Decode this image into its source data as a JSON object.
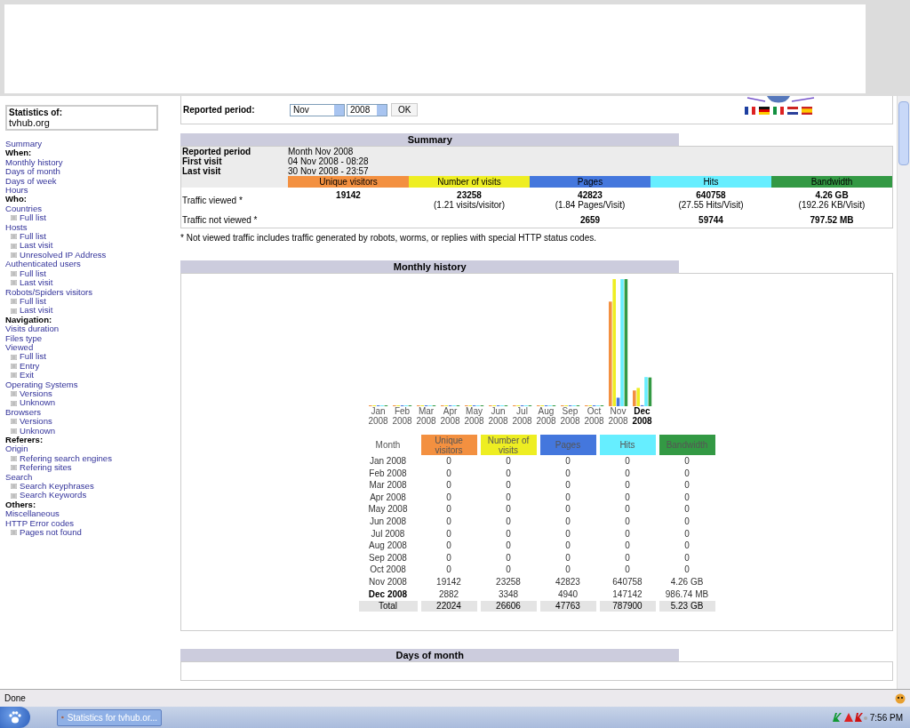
{
  "sidebar": {
    "title": "Statistics of:",
    "site": "tvhub.org",
    "items": [
      {
        "label": "Summary",
        "kind": "link"
      },
      {
        "label": "When:",
        "kind": "heading"
      },
      {
        "label": "Monthly history",
        "kind": "link"
      },
      {
        "label": "Days of month",
        "kind": "link"
      },
      {
        "label": "Days of week",
        "kind": "link"
      },
      {
        "label": "Hours",
        "kind": "link"
      },
      {
        "label": "Who:",
        "kind": "heading"
      },
      {
        "label": "Countries",
        "kind": "link"
      },
      {
        "label": "Full list",
        "kind": "sublink"
      },
      {
        "label": "Hosts",
        "kind": "link"
      },
      {
        "label": "Full list",
        "kind": "sublink"
      },
      {
        "label": "Last visit",
        "kind": "sublink"
      },
      {
        "label": "Unresolved IP Address",
        "kind": "sublink"
      },
      {
        "label": "Authenticated users",
        "kind": "link"
      },
      {
        "label": "Full list",
        "kind": "sublink"
      },
      {
        "label": "Last visit",
        "kind": "sublink"
      },
      {
        "label": "Robots/Spiders visitors",
        "kind": "link"
      },
      {
        "label": "Full list",
        "kind": "sublink"
      },
      {
        "label": "Last visit",
        "kind": "sublink"
      },
      {
        "label": "Navigation:",
        "kind": "heading"
      },
      {
        "label": "Visits duration",
        "kind": "link"
      },
      {
        "label": "Files type",
        "kind": "link"
      },
      {
        "label": "Viewed",
        "kind": "link"
      },
      {
        "label": "Full list",
        "kind": "sublink"
      },
      {
        "label": "Entry",
        "kind": "sublink"
      },
      {
        "label": "Exit",
        "kind": "sublink"
      },
      {
        "label": "Operating Systems",
        "kind": "link"
      },
      {
        "label": "Versions",
        "kind": "sublink"
      },
      {
        "label": "Unknown",
        "kind": "sublink"
      },
      {
        "label": "Browsers",
        "kind": "link"
      },
      {
        "label": "Versions",
        "kind": "sublink"
      },
      {
        "label": "Unknown",
        "kind": "sublink"
      },
      {
        "label": "Referers:",
        "kind": "heading"
      },
      {
        "label": "Origin",
        "kind": "link"
      },
      {
        "label": "Refering search engines",
        "kind": "sublink"
      },
      {
        "label": "Refering sites",
        "kind": "sublink"
      },
      {
        "label": "Search",
        "kind": "link"
      },
      {
        "label": "Search Keyphrases",
        "kind": "sublink"
      },
      {
        "label": "Search Keywords",
        "kind": "sublink"
      },
      {
        "label": "Others:",
        "kind": "heading"
      },
      {
        "label": "Miscellaneous",
        "kind": "link"
      },
      {
        "label": "HTTP Error codes",
        "kind": "link"
      },
      {
        "label": "Pages not found",
        "kind": "sublink"
      }
    ]
  },
  "period": {
    "label": "Reported period:",
    "month": "Nov",
    "year": "2008",
    "button": "OK"
  },
  "summary": {
    "title": "Summary",
    "info": [
      {
        "label": "Reported period",
        "value": "Month Nov 2008"
      },
      {
        "label": "First visit",
        "value": "04 Nov 2008 - 08:28"
      },
      {
        "label": "Last visit",
        "value": "30 Nov 2008 - 23:57"
      }
    ],
    "columns": [
      {
        "label": "Unique visitors",
        "color": "#f39040"
      },
      {
        "label": "Number of visits",
        "color": "#eeee22"
      },
      {
        "label": "Pages",
        "color": "#4477dd"
      },
      {
        "label": "Hits",
        "color": "#66eeff"
      },
      {
        "label": "Bandwidth",
        "color": "#339944"
      }
    ],
    "rows": [
      {
        "label": "Traffic viewed *",
        "cells": [
          {
            "value": "19142"
          },
          {
            "value": "23258",
            "detail": "(1.21 visits/visitor)"
          },
          {
            "value": "42823",
            "detail": "(1.84 Pages/Visit)"
          },
          {
            "value": "640758",
            "detail": "(27.55 Hits/Visit)"
          },
          {
            "value": "4.26 GB",
            "detail": "(192.26 KB/Visit)"
          }
        ]
      },
      {
        "label": "Traffic not viewed *",
        "cells": [
          null,
          null,
          {
            "value": "2659"
          },
          {
            "value": "59744"
          },
          {
            "value": "797.52 MB"
          }
        ]
      }
    ]
  },
  "footnote": "* Not viewed traffic includes traffic generated by robots, worms, or replies with special HTTP status codes.",
  "monthly": {
    "title": "Monthly history",
    "chart_months": [
      {
        "month": "Jan",
        "year": "2008",
        "current": false
      },
      {
        "month": "Feb",
        "year": "2008",
        "current": false
      },
      {
        "month": "Mar",
        "year": "2008",
        "current": false
      },
      {
        "month": "Apr",
        "year": "2008",
        "current": false
      },
      {
        "month": "May",
        "year": "2008",
        "current": false
      },
      {
        "month": "Jun",
        "year": "2008",
        "current": false
      },
      {
        "month": "Jul",
        "year": "2008",
        "current": false
      },
      {
        "month": "Aug",
        "year": "2008",
        "current": false
      },
      {
        "month": "Sep",
        "year": "2008",
        "current": false
      },
      {
        "month": "Oct",
        "year": "2008",
        "current": false
      },
      {
        "month": "Nov",
        "year": "2008",
        "current": false
      },
      {
        "month": "Dec",
        "year": "2008",
        "current": true
      }
    ],
    "columns": [
      {
        "label": "Month"
      },
      {
        "label": "Unique visitors",
        "color": "#f39040"
      },
      {
        "label": "Number of visits",
        "color": "#eeee22"
      },
      {
        "label": "Pages",
        "color": "#4477dd"
      },
      {
        "label": "Hits",
        "color": "#66eeff"
      },
      {
        "label": "Bandwidth",
        "color": "#339944"
      }
    ],
    "rows": [
      {
        "month": "Jan 2008",
        "current": false,
        "values": [
          "0",
          "0",
          "0",
          "0",
          "0"
        ]
      },
      {
        "month": "Feb 2008",
        "current": false,
        "values": [
          "0",
          "0",
          "0",
          "0",
          "0"
        ]
      },
      {
        "month": "Mar 2008",
        "current": false,
        "values": [
          "0",
          "0",
          "0",
          "0",
          "0"
        ]
      },
      {
        "month": "Apr 2008",
        "current": false,
        "values": [
          "0",
          "0",
          "0",
          "0",
          "0"
        ]
      },
      {
        "month": "May 2008",
        "current": false,
        "values": [
          "0",
          "0",
          "0",
          "0",
          "0"
        ]
      },
      {
        "month": "Jun 2008",
        "current": false,
        "values": [
          "0",
          "0",
          "0",
          "0",
          "0"
        ]
      },
      {
        "month": "Jul 2008",
        "current": false,
        "values": [
          "0",
          "0",
          "0",
          "0",
          "0"
        ]
      },
      {
        "month": "Aug 2008",
        "current": false,
        "values": [
          "0",
          "0",
          "0",
          "0",
          "0"
        ]
      },
      {
        "month": "Sep 2008",
        "current": false,
        "values": [
          "0",
          "0",
          "0",
          "0",
          "0"
        ]
      },
      {
        "month": "Oct 2008",
        "current": false,
        "values": [
          "0",
          "0",
          "0",
          "0",
          "0"
        ]
      },
      {
        "month": "Nov 2008",
        "current": false,
        "values": [
          "19142",
          "23258",
          "42823",
          "640758",
          "4.26 GB"
        ]
      },
      {
        "month": "Dec 2008",
        "current": true,
        "values": [
          "2882",
          "3348",
          "4940",
          "147142",
          "986.74 MB"
        ]
      }
    ],
    "total": {
      "label": "Total",
      "values": [
        "22024",
        "26606",
        "47763",
        "787900",
        "5.23 GB"
      ]
    }
  },
  "days_of_month": {
    "title": "Days of month"
  },
  "status_bar": {
    "text": "Done"
  },
  "taskbar": {
    "task": "Statistics for tvhub.or...",
    "time": "7:56 PM"
  }
}
